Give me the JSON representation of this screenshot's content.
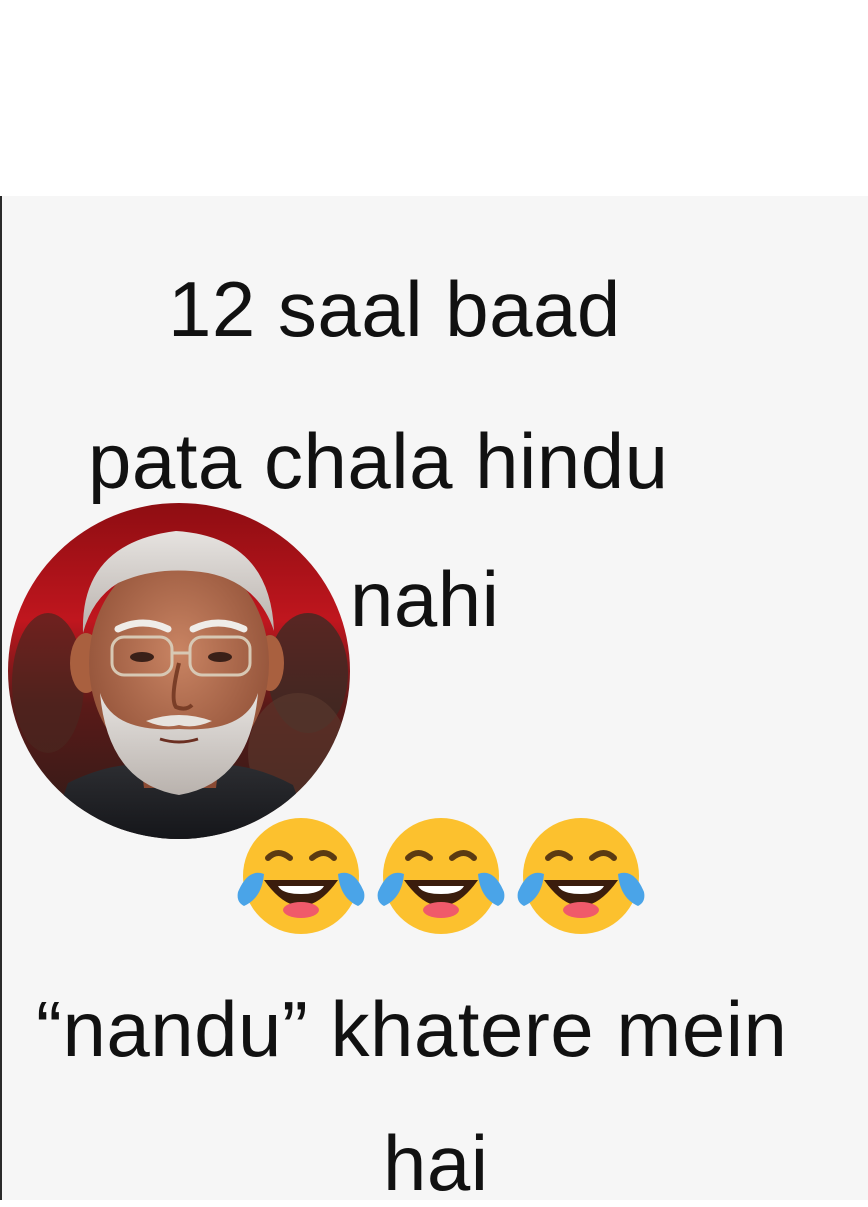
{
  "caption": {
    "line1": "12 saal baad",
    "line2": "pata chala hindu",
    "line3": "nahi",
    "line4": "“nandu” khatere mein",
    "line5": "hai"
  },
  "emojis": [
    "face-with-tears-of-joy-icon",
    "face-with-tears-of-joy-icon",
    "face-with-tears-of-joy-icon"
  ],
  "colors": {
    "text": "#111111",
    "panel_background": "#f6f6f6",
    "emoji_face": "#fcc12e",
    "emoji_tears": "#4aa4e8",
    "photo_background": "#b3131b"
  }
}
